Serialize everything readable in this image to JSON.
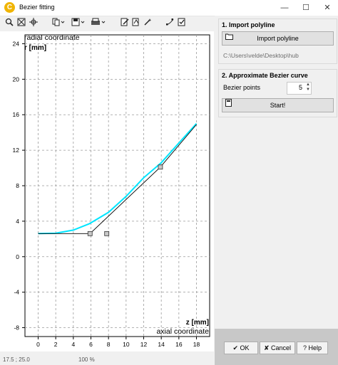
{
  "window": {
    "title": "Bezier fitting",
    "app_icon_letter": "C",
    "controls": [
      "—",
      "☐",
      "✕"
    ]
  },
  "toolbar": {
    "icons": [
      "zoom-icon",
      "zoom-fit-icon",
      "pan-icon",
      "copy-icon",
      "save-icon",
      "print-icon",
      "edit-icon",
      "transform-icon",
      "sparkle-icon",
      "points-icon",
      "checklist-icon"
    ]
  },
  "plot": {
    "y_axis_title": "radial coordinate",
    "y_unit_label": "r [mm]",
    "x_unit_label": "z [mm]",
    "x_axis_title": "axial coordinate",
    "x_ticks": [
      "0",
      "2",
      "4",
      "6",
      "8",
      "10",
      "12",
      "14",
      "16",
      "18"
    ],
    "y_ticks": [
      "24",
      "20",
      "16",
      "12",
      "8",
      "4",
      "0",
      "-4",
      "-8"
    ],
    "curve_color": "#00e5ff",
    "polyline_color": "#000000"
  },
  "chart_data": {
    "type": "line",
    "xlabel": "axial coordinate",
    "ylabel": "radial coordinate",
    "xlim": [
      -1.5,
      19.5
    ],
    "ylim": [
      -9,
      25
    ],
    "grid": true,
    "series": [
      {
        "x": [
          0,
          2,
          4,
          5.8,
          8,
          10,
          12,
          14,
          16,
          18
        ],
        "y": [
          2.6,
          2.65,
          3.0,
          3.7,
          5.0,
          6.8,
          8.9,
          10.6,
          12.8,
          15.0
        ]
      },
      {
        "x": [
          0,
          3,
          5.9,
          13.9,
          18
        ],
        "y": [
          2.6,
          2.6,
          2.6,
          10.1,
          14.9
        ]
      }
    ],
    "control_points": {
      "x": [
        5.9,
        7.8,
        13.9
      ],
      "y": [
        2.6,
        2.6,
        10.1
      ]
    }
  },
  "status": {
    "coords": "17.5 ; 25.0",
    "zoom": "100 %"
  },
  "panel": {
    "import": {
      "title": "1. Import polyline",
      "button_label": "Import polyline",
      "path": "C:\\Users\\velde\\Desktop\\hub"
    },
    "approx": {
      "title": "2. Approximate Bezier curve",
      "points_label": "Bezier points",
      "points_value": "5",
      "start_label": "Start!"
    }
  },
  "footer": {
    "ok": "OK",
    "cancel": "Cancel",
    "help": "Help"
  }
}
